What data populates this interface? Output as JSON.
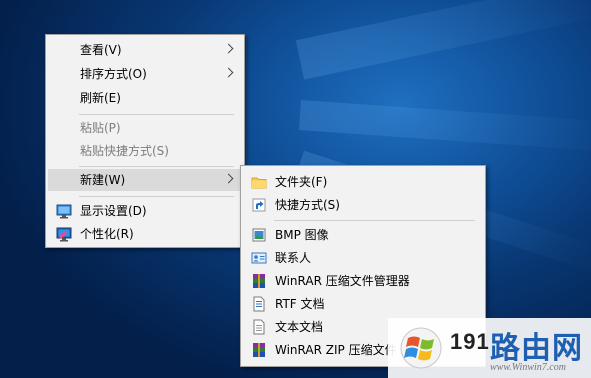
{
  "context_menu": {
    "items": [
      {
        "label": "查看(V)"
      },
      {
        "label": "排序方式(O)"
      },
      {
        "label": "刷新(E)"
      },
      {
        "label": "粘贴(P)"
      },
      {
        "label": "粘贴快捷方式(S)"
      },
      {
        "label": "新建(W)"
      },
      {
        "label": "显示设置(D)"
      },
      {
        "label": "个性化(R)"
      }
    ]
  },
  "new_submenu": {
    "items": [
      {
        "label": "文件夹(F)",
        "icon": "folder-icon"
      },
      {
        "label": "快捷方式(S)",
        "icon": "shortcut-icon"
      },
      {
        "label": "BMP 图像",
        "icon": "bitmap-image-icon"
      },
      {
        "label": "联系人",
        "icon": "contact-card-icon"
      },
      {
        "label": "WinRAR 压缩文件管理器",
        "icon": "winrar-archive-icon"
      },
      {
        "label": "RTF 文档",
        "icon": "rtf-document-icon"
      },
      {
        "label": "文本文档",
        "icon": "text-document-icon"
      },
      {
        "label": "WinRAR ZIP 压缩文件",
        "icon": "winrar-zip-icon"
      }
    ]
  },
  "watermark": {
    "number": "191",
    "name": "路由网",
    "url": "www.Winwin7.com"
  },
  "colors": {
    "desktop": "#0b3f82",
    "menu_background": "#f2f2f2",
    "hover": "#dadada",
    "disabled_text": "#7d7d7d",
    "watermark_blue": "#1d5fb0"
  }
}
